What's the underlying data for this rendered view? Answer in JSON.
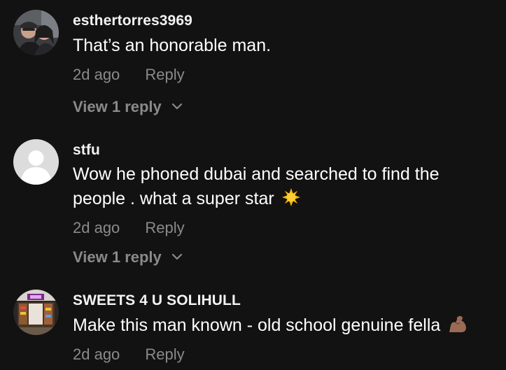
{
  "comments": [
    {
      "username": "esthertorres3969",
      "text": "That’s an honorable man.",
      "time": "2d ago",
      "reply_label": "Reply",
      "view_replies": "View 1 reply",
      "avatar": "photo-avatar"
    },
    {
      "username": "stfu",
      "text": "Wow he phoned dubai and searched to find the people . what a super star",
      "emoji": "sun-emoji",
      "time": "2d ago",
      "reply_label": "Reply",
      "view_replies": "View 1 reply",
      "avatar": "default-avatar"
    },
    {
      "username": "SWEETS 4 U SOLIHULL",
      "text": "Make this man known - old school genuine fella",
      "emoji": "flexed-biceps-emoji",
      "time": "2d ago",
      "reply_label": "Reply",
      "avatar": "shop-photo-avatar"
    }
  ],
  "colors": {
    "background": "#121212",
    "username": "#f2f2f2",
    "text": "#ffffff",
    "meta": "#8a8a8a"
  }
}
